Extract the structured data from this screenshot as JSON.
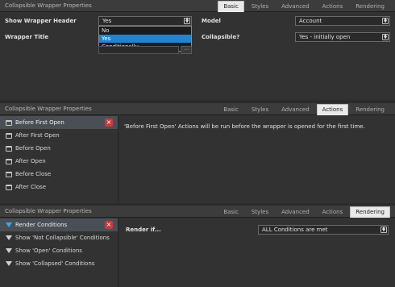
{
  "panel1": {
    "title": "Collapsible Wrapper Properties",
    "tabs": [
      "Basic",
      "Styles",
      "Advanced",
      "Actions",
      "Rendering"
    ],
    "active_tab": "Basic",
    "show_wrapper_header": {
      "label": "Show Wrapper Header",
      "value": "Yes"
    },
    "dropdown_options": [
      "No",
      "Yes",
      "Conditionally"
    ],
    "dropdown_selected": "Yes",
    "wrapper_title": {
      "label": "Wrapper Title"
    },
    "model": {
      "label": "Model",
      "value": "Account"
    },
    "collapsible": {
      "label": "Collapsible?",
      "value": "Yes - initially open"
    }
  },
  "panel2": {
    "title": "Collapsible Wrapper Properties",
    "tabs": [
      "Basic",
      "Styles",
      "Advanced",
      "Actions",
      "Rendering"
    ],
    "active_tab": "Actions",
    "items": [
      "Before First Open",
      "After First Open",
      "Before Open",
      "After Open",
      "Before Close",
      "After Close"
    ],
    "message": "'Before First Open' Actions will be run before the wrapper is opened for the first time."
  },
  "panel3": {
    "title": "Collapsible Wrapper Properties",
    "tabs": [
      "Basic",
      "Styles",
      "Advanced",
      "Actions",
      "Rendering"
    ],
    "active_tab": "Rendering",
    "items": [
      "Render Conditions",
      "Show 'Not Collapsible' Conditions",
      "Show 'Open' Conditions",
      "Show 'Collapsed' Conditions"
    ],
    "render_if": {
      "label": "Render if...",
      "value": "ALL Conditions are met"
    }
  },
  "icons": {
    "delete": "×",
    "dropdown_arrow": "⬍"
  },
  "colors": {
    "active_tab_bg": "#e9e9e9",
    "selected_option": "#1e84d8",
    "delete_button": "#c83a3a"
  }
}
